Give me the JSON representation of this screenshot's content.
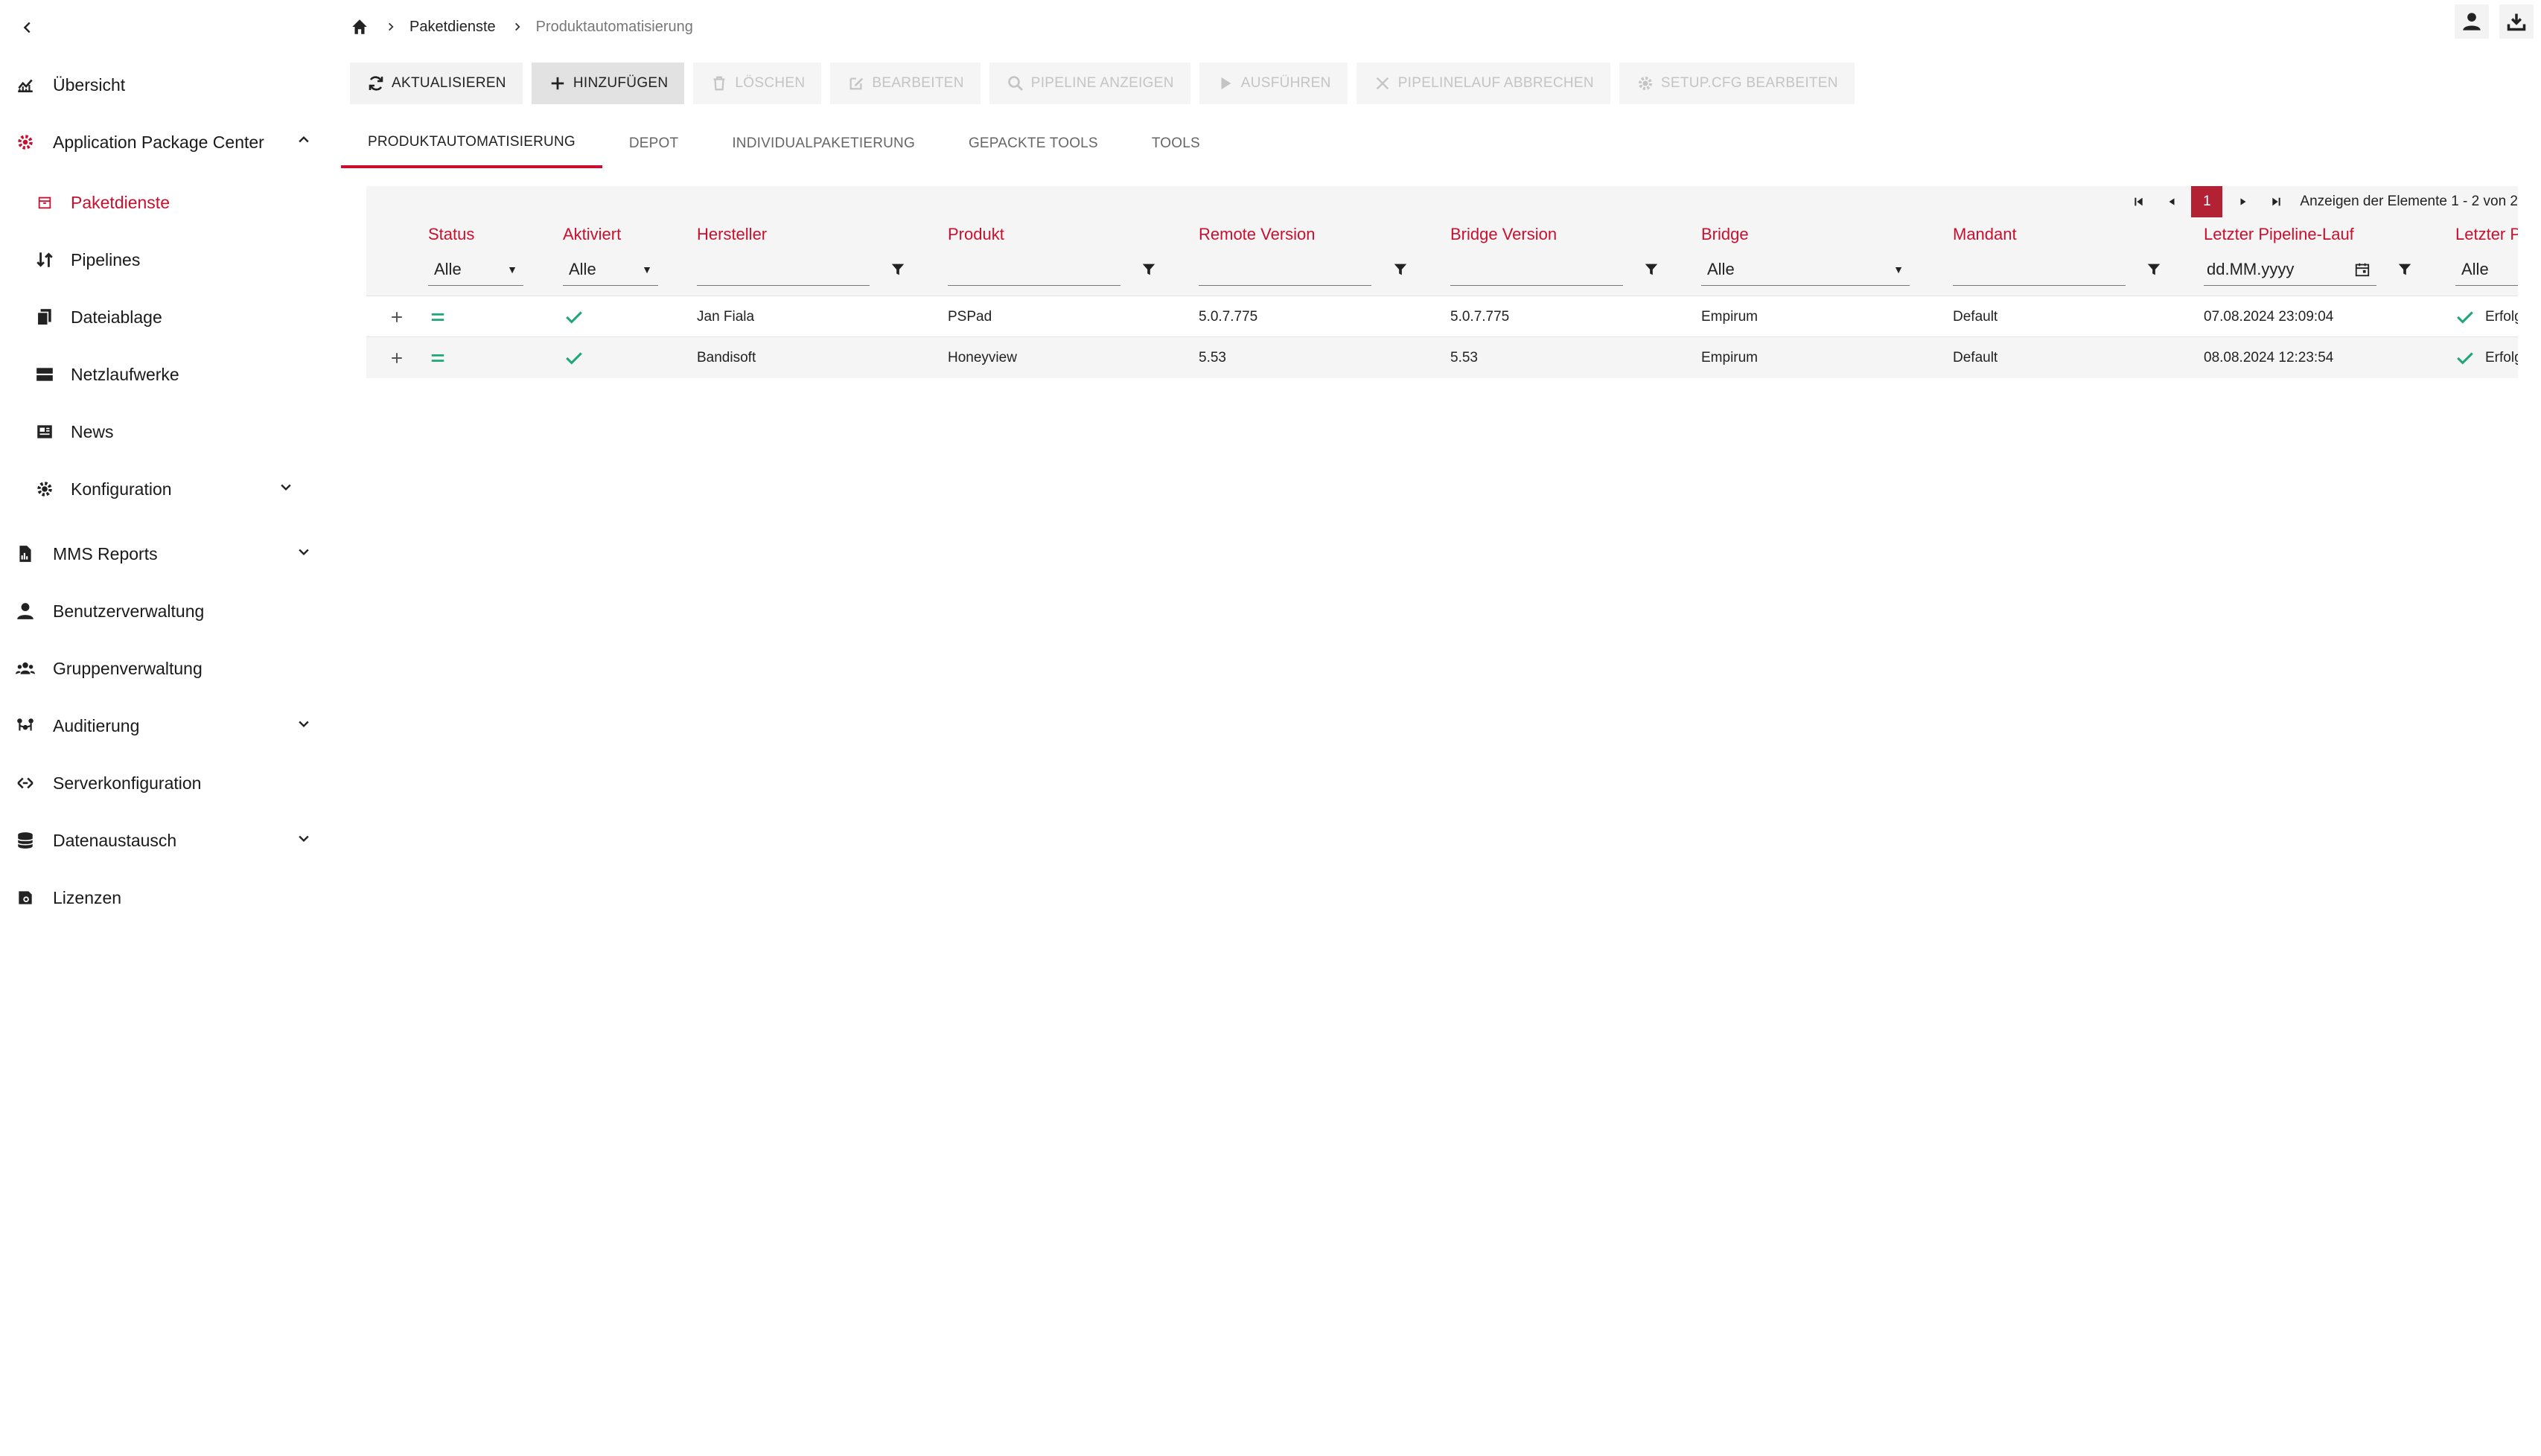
{
  "sidebar": {
    "items": [
      {
        "label": "Übersicht"
      },
      {
        "label": "Application Package Center"
      },
      {
        "label": "Paketdienste"
      },
      {
        "label": "Pipelines"
      },
      {
        "label": "Dateiablage"
      },
      {
        "label": "Netzlaufwerke"
      },
      {
        "label": "News"
      },
      {
        "label": "Konfiguration"
      },
      {
        "label": "MMS Reports"
      },
      {
        "label": "Benutzerverwaltung"
      },
      {
        "label": "Gruppenverwaltung"
      },
      {
        "label": "Auditierung"
      },
      {
        "label": "Serverkonfiguration"
      },
      {
        "label": "Datenaustausch"
      },
      {
        "label": "Lizenzen"
      }
    ]
  },
  "breadcrumb": {
    "items": [
      "Paketdienste",
      "Produktautomatisierung"
    ]
  },
  "toolbar": {
    "buttons": [
      {
        "label": "Aktualisieren"
      },
      {
        "label": "Hinzufügen"
      },
      {
        "label": "Löschen"
      },
      {
        "label": "Bearbeiten"
      },
      {
        "label": "Pipeline anzeigen"
      },
      {
        "label": "Ausführen"
      },
      {
        "label": "Pipelinelauf abbrechen"
      },
      {
        "label": "setup.cfg bearbeiten"
      }
    ]
  },
  "tabs": [
    {
      "label": "Produktautomatisierung"
    },
    {
      "label": "Depot"
    },
    {
      "label": "Individualpaketierung"
    },
    {
      "label": "Gepackte Tools"
    },
    {
      "label": "Tools"
    }
  ],
  "pager": {
    "page": "1",
    "info": "Anzeigen der Elemente 1 - 2 von 2"
  },
  "grid": {
    "columns": [
      {
        "label": "Status"
      },
      {
        "label": "Aktiviert"
      },
      {
        "label": "Hersteller"
      },
      {
        "label": "Produkt"
      },
      {
        "label": "Remote Version"
      },
      {
        "label": "Bridge Version"
      },
      {
        "label": "Bridge"
      },
      {
        "label": "Mandant"
      },
      {
        "label": "Letzter Pipeline-Lauf"
      },
      {
        "label": "Letzter Pipeline-Status"
      }
    ],
    "filters": {
      "status": "Alle",
      "aktiviert": "Alle",
      "bridge": "Alle",
      "date_placeholder": "dd.MM.yyyy",
      "last_status": "Alle"
    },
    "rows": [
      {
        "hersteller": "Jan Fiala",
        "produkt": "PSPad",
        "remote_version": "5.0.7.775",
        "bridge_version": "5.0.7.775",
        "bridge": "Empirum",
        "mandant": "Default",
        "letzter_lauf": "07.08.2024 23:09:04",
        "letzter_status": "Erfolgreich"
      },
      {
        "hersteller": "Bandisoft",
        "produkt": "Honeyview",
        "remote_version": "5.53",
        "bridge_version": "5.53",
        "bridge": "Empirum",
        "mandant": "Default",
        "letzter_lauf": "08.08.2024 12:23:54",
        "letzter_status": "Erfolgreich"
      }
    ]
  },
  "colors": {
    "accent": "#c8102e",
    "status_ok": "#1fa67a"
  }
}
